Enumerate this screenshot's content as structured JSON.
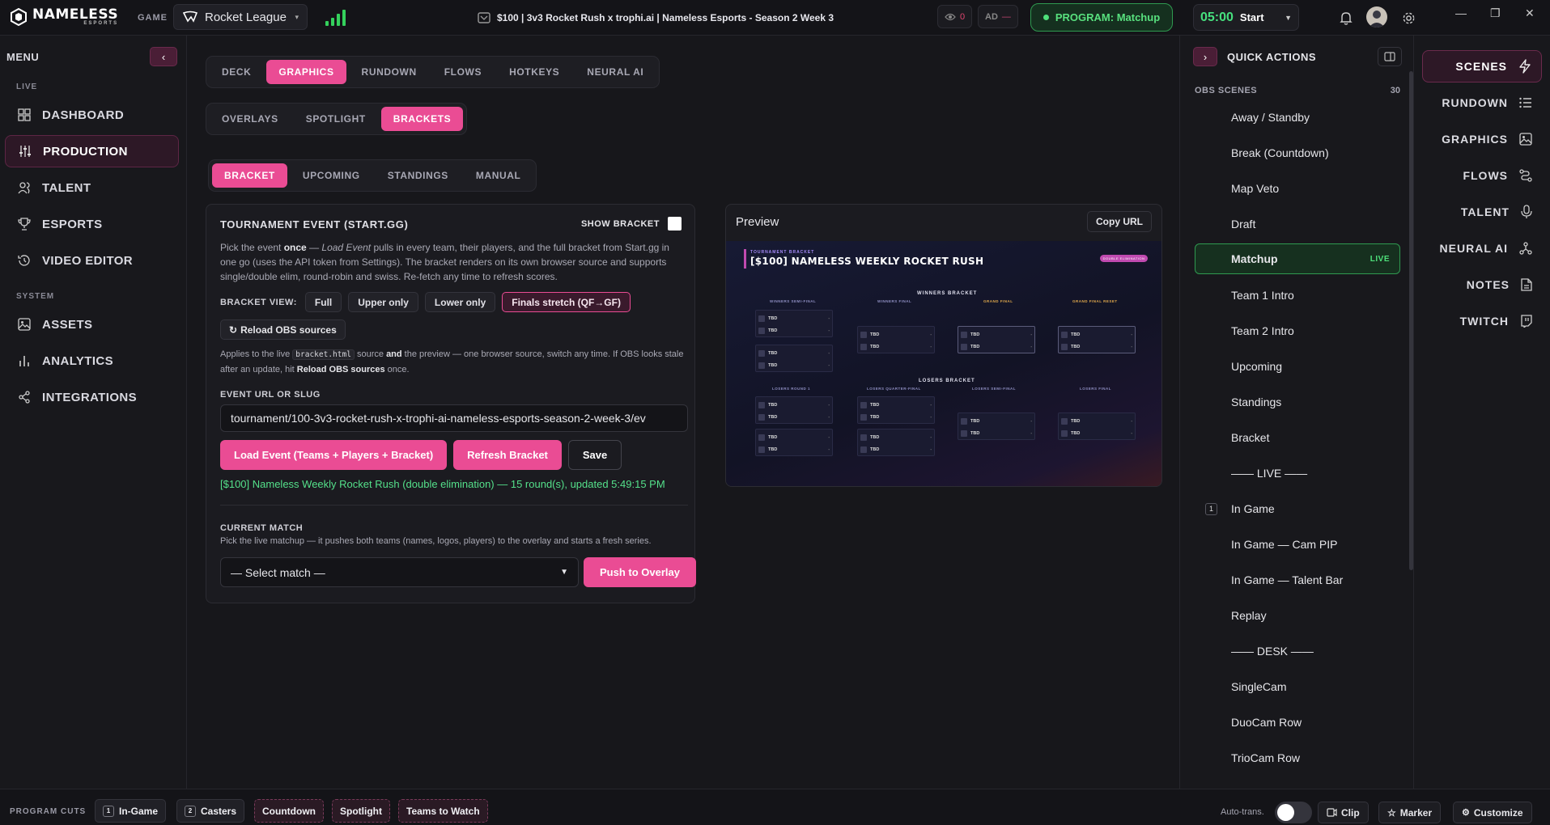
{
  "topbar": {
    "logo_text": "NAMELESS",
    "logo_sub": "ESPORTS",
    "game_label": "GAME",
    "game_value": "Rocket League",
    "title": "$100 | 3v3 Rocket Rush x trophi.ai | Nameless Esports - Season 2 Week 3",
    "viewers": "0",
    "ad_label": "AD",
    "ad_value": "—",
    "program": "PROGRAM: Matchup",
    "timer": "05:00",
    "timer_action": "Start"
  },
  "sidebar": {
    "menu_label": "MENU",
    "live_label": "LIVE",
    "system_label": "SYSTEM",
    "live_items": [
      {
        "label": "DASHBOARD"
      },
      {
        "label": "PRODUCTION"
      },
      {
        "label": "TALENT"
      },
      {
        "label": "ESPORTS"
      },
      {
        "label": "VIDEO EDITOR"
      }
    ],
    "system_items": [
      {
        "label": "ASSETS"
      },
      {
        "label": "ANALYTICS"
      },
      {
        "label": "INTEGRATIONS"
      }
    ]
  },
  "tabs": {
    "main": [
      "DECK",
      "GRAPHICS",
      "RUNDOWN",
      "FLOWS",
      "HOTKEYS",
      "NEURAL AI"
    ],
    "sub": [
      "OVERLAYS",
      "SPOTLIGHT",
      "BRACKETS"
    ],
    "bracket": [
      "BRACKET",
      "UPCOMING",
      "STANDINGS",
      "MANUAL"
    ]
  },
  "event_card": {
    "title": "TOURNAMENT EVENT (START.GG)",
    "show_bracket": "SHOW BRACKET",
    "desc_1": "Pick the event ",
    "desc_once": "once",
    "desc_2": " — ",
    "desc_em": "Load Event",
    "desc_3": " pulls in every team, their players, and the full bracket from Start.gg in one go (uses the API token from Settings). The bracket renders on its own browser source and supports single/double elim, round-robin and swiss. Re-fetch any time to refresh scores.",
    "bracket_view_label": "BRACKET VIEW:",
    "view_options": [
      "Full",
      "Upper only",
      "Lower only",
      "Finals stretch (QF→GF)"
    ],
    "reload": "Reload OBS sources",
    "note_1": "Applies to the live ",
    "note_code": "bracket.html",
    "note_2": " source ",
    "note_and": "and",
    "note_3": " the preview — one browser source, switch any time. If OBS looks stale after an update, hit ",
    "note_reload": "Reload OBS sources",
    "note_4": " once.",
    "url_label": "EVENT URL OR SLUG",
    "url_value": "tournament/100-3v3-rocket-rush-x-trophi-ai-nameless-esports-season-2-week-3/ev",
    "load_btn": "Load Event (Teams + Players + Bracket)",
    "refresh_btn": "Refresh Bracket",
    "save_btn": "Save",
    "status": "[$100] Nameless Weekly Rocket Rush (double elimination) — 15 round(s), updated 5:49:15 PM",
    "current_match_label": "CURRENT MATCH",
    "current_match_desc": "Pick the live matchup — it pushes both teams (names, logos, players) to the overlay and starts a fresh series.",
    "select_value": "— Select match —",
    "push_btn": "Push to Overlay"
  },
  "preview": {
    "title": "Preview",
    "copy_url": "Copy URL",
    "small_label": "TOURNAMENT BRACKET",
    "event_name": "[$100] NAMELESS WEEKLY ROCKET RUSH",
    "badge": "DOUBLE ELIMINATION",
    "winners_label": "WINNERS BRACKET",
    "losers_label": "LOSERS BRACKET",
    "winners_rounds": [
      "WINNERS SEMI-FINAL",
      "WINNERS FINAL",
      "GRAND FINAL",
      "GRAND FINAL RESET"
    ],
    "losers_rounds": [
      "LOSERS ROUND 1",
      "LOSERS QUARTER-FINAL",
      "LOSERS SEMI-FINAL",
      "LOSERS FINAL"
    ],
    "team": "TBD",
    "score": "-"
  },
  "quick_actions": {
    "title": "QUICK ACTIONS",
    "obs_label": "OBS SCENES",
    "obs_count": "30",
    "live_tag": "LIVE",
    "scenes": [
      {
        "name": "Away / Standby"
      },
      {
        "name": "Break (Countdown)"
      },
      {
        "name": "Map Veto"
      },
      {
        "name": "Draft"
      },
      {
        "name": "Matchup",
        "live": true
      },
      {
        "name": "Team 1 Intro"
      },
      {
        "name": "Team 2 Intro"
      },
      {
        "name": "Upcoming"
      },
      {
        "name": "Standings"
      },
      {
        "name": "Bracket"
      },
      {
        "name": "—— LIVE ——"
      },
      {
        "name": "In Game",
        "key": "1"
      },
      {
        "name": "In Game — Cam PIP"
      },
      {
        "name": "In Game — Talent Bar"
      },
      {
        "name": "Replay"
      },
      {
        "name": "—— DESK ——"
      },
      {
        "name": "SingleCam"
      },
      {
        "name": "DuoCam Row"
      },
      {
        "name": "TrioCam Row"
      }
    ]
  },
  "right_nav": [
    "SCENES",
    "RUNDOWN",
    "GRAPHICS",
    "FLOWS",
    "TALENT",
    "NEURAL AI",
    "NOTES",
    "TWITCH"
  ],
  "bottom": {
    "program_cuts": "PROGRAM CUTS",
    "cuts": [
      {
        "label": "In-Game",
        "key": "1"
      },
      {
        "label": "Casters",
        "key": "2"
      },
      {
        "label": "Countdown"
      },
      {
        "label": "Spotlight"
      },
      {
        "label": "Teams to Watch"
      }
    ],
    "auto_trans": "Auto-trans.",
    "clip": "Clip",
    "marker": "Marker",
    "customize": "Customize"
  },
  "colors": {
    "accent": "#ea4c94",
    "live": "#4ee07a"
  }
}
